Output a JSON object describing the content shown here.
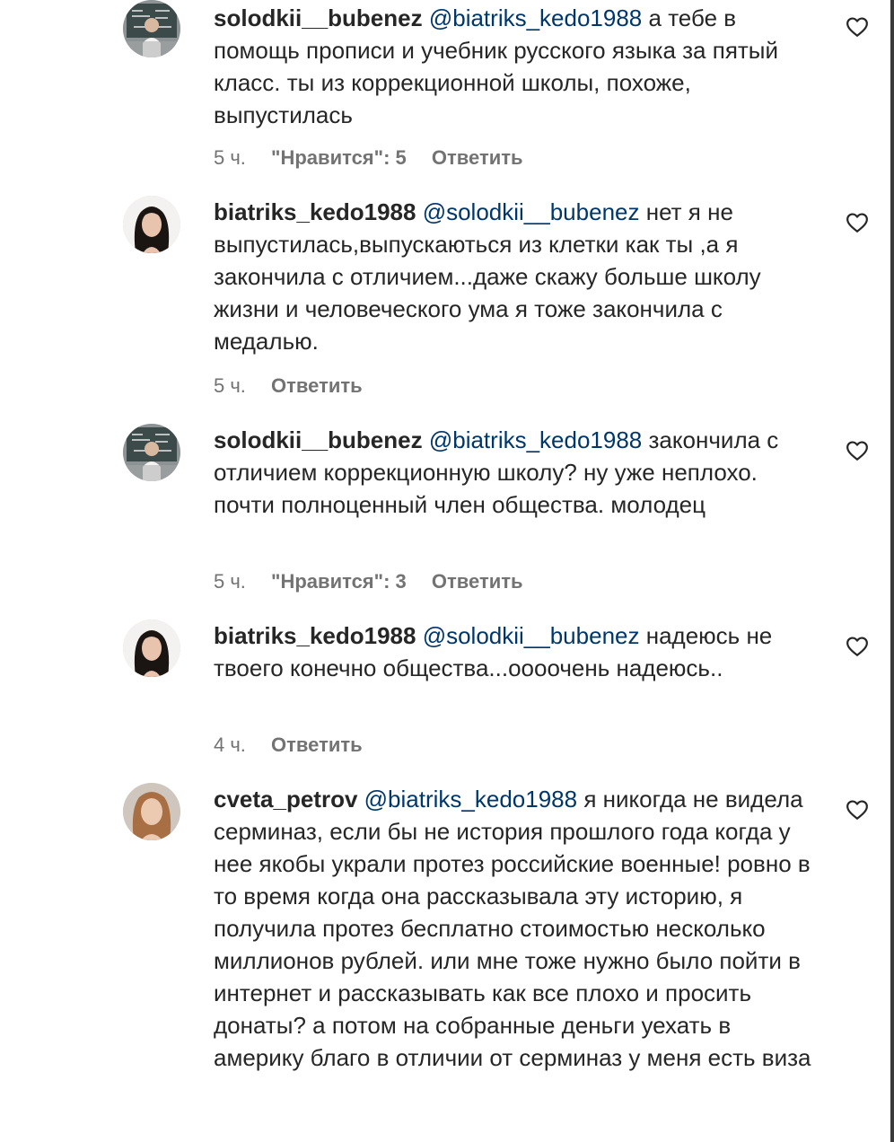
{
  "comments": [
    {
      "username": "solodkii__bubenez",
      "mention": "@biatriks_kedo1988",
      "text": " а тебе в помощь прописи и учебник русского языка за пятый класс. ты из коррекционной школы, похоже, выпустилась",
      "time": "5 ч.",
      "likes": "\"Нравится\": 5",
      "reply": "Ответить",
      "avatar_icon": "chalkboard-avatar"
    },
    {
      "username": "biatriks_kedo1988",
      "mention": "@solodkii__bubenez",
      "text": " нет я не выпустилась,выпускаються из клетки как ты ,а я закончила с отличием...даже скажу больше школу жизни и человеческого ума я тоже закончила с медалью.",
      "time": "5 ч.",
      "likes": "",
      "reply": "Ответить",
      "avatar_icon": "woman-dark-hair-avatar"
    },
    {
      "username": "solodkii__bubenez",
      "mention": "@biatriks_kedo1988",
      "text": " закончила с отличием коррекционную школу? ну уже неплохо. почти полноценный член общества. молодец",
      "time": "5 ч.",
      "likes": "\"Нравится\": 3",
      "reply": "Ответить",
      "avatar_icon": "chalkboard-avatar"
    },
    {
      "username": "biatriks_kedo1988",
      "mention": "@solodkii__bubenez",
      "text": " надеюсь не твоего конечно общества...оооочень надеюсь..",
      "time": "4 ч.",
      "likes": "",
      "reply": "Ответить",
      "avatar_icon": "woman-dark-hair-avatar"
    },
    {
      "username": "cveta_petrov",
      "mention": "@biatriks_kedo1988",
      "text": " я никогда не видела серминаз, если бы не история прошлого года когда у нее якобы украли протез российские военные! ровно в то время когда она рассказывала эту историю, я получила протез бесплатно стоимостью несколько миллионов рублей. или мне тоже нужно было пойти в интернет и рассказывать как все плохо и просить донаты? а потом на собранные деньги уехать в америку благо в отличии от серминаз у меня есть виза",
      "time": "",
      "likes": "",
      "reply": "",
      "avatar_icon": "woman-light-hair-avatar"
    }
  ],
  "colors": {
    "text": "#262626",
    "mention": "#00376b",
    "meta": "#737373"
  }
}
